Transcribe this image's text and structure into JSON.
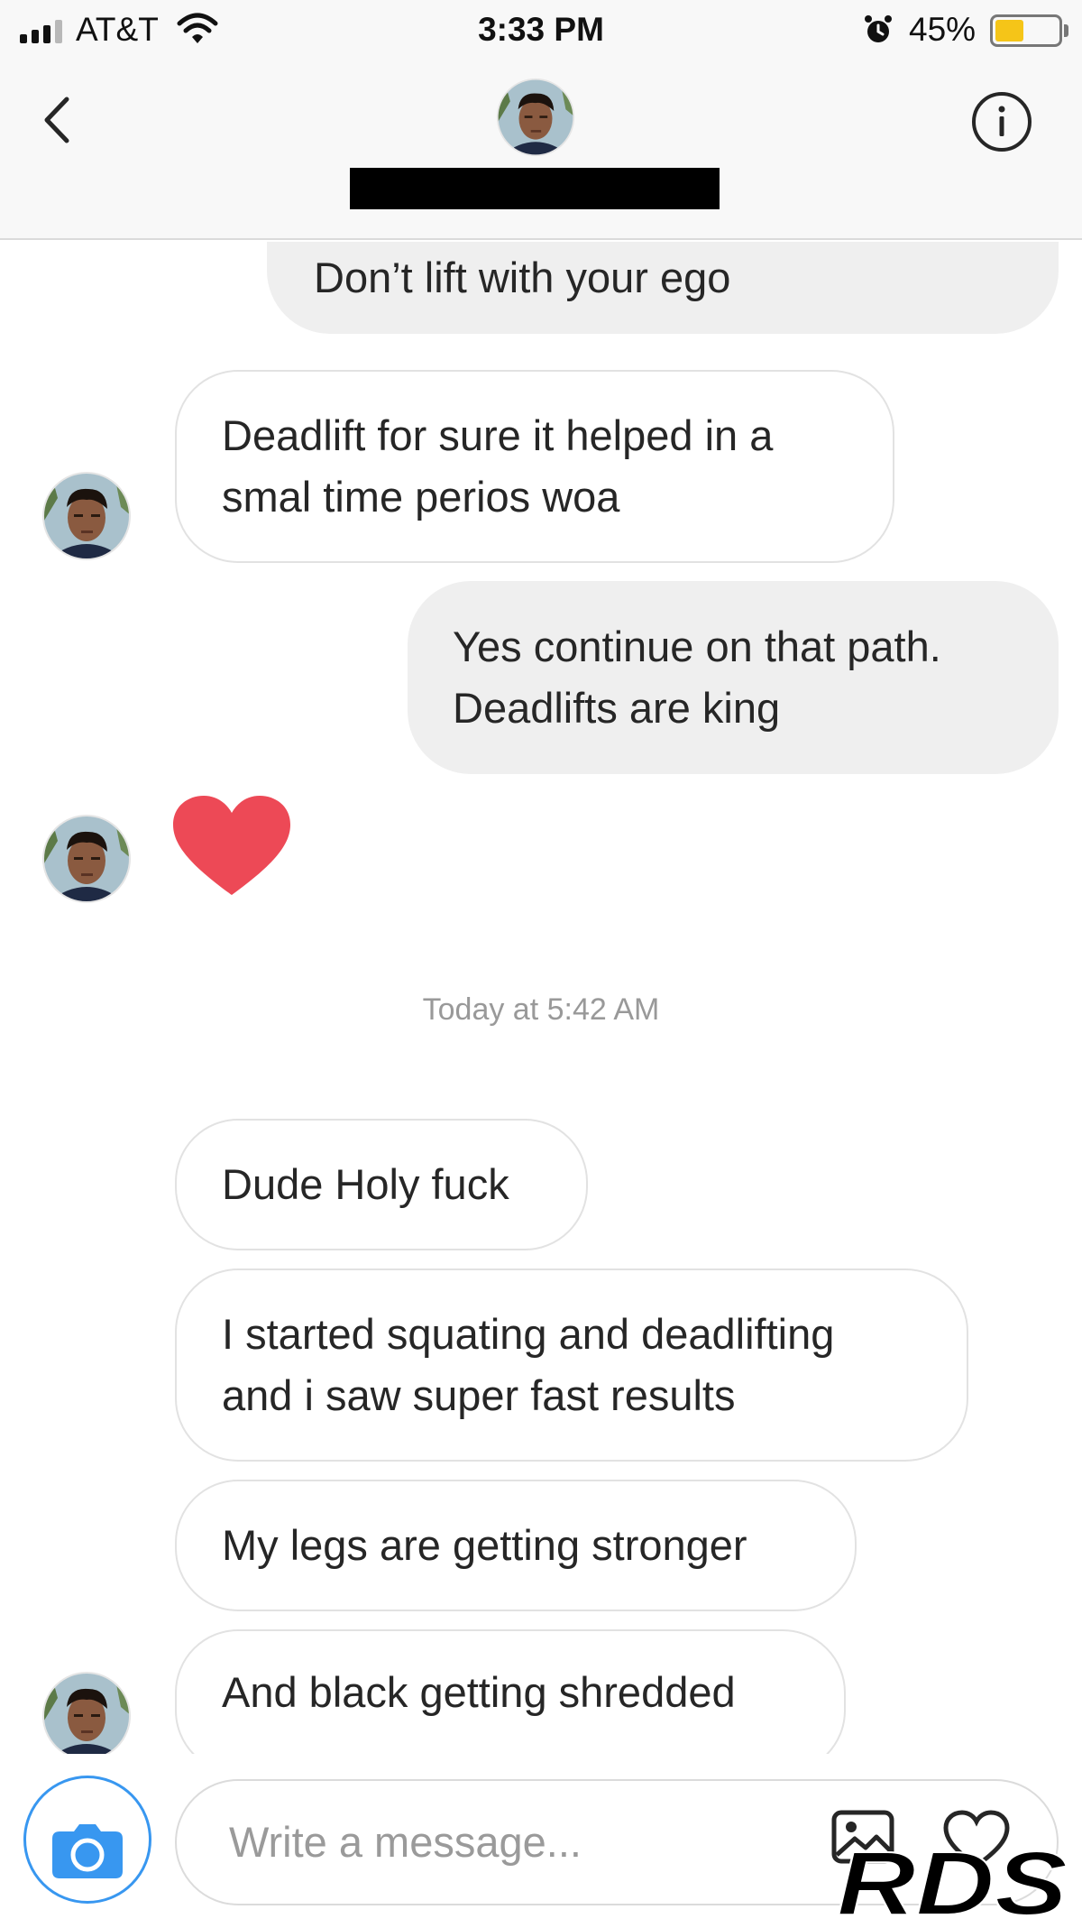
{
  "status_bar": {
    "carrier": "AT&T",
    "time": "3:33 PM",
    "battery_percent": "45%",
    "battery_level": 0.45,
    "battery_color": "#f5c518",
    "signal_bars_on": 3,
    "signal_bars_total": 4
  },
  "header": {
    "back_icon": "chevron-left-icon",
    "info_icon": "info-icon",
    "contact_name_redacted": true
  },
  "messages": [
    {
      "direction": "outgoing",
      "text": "Don’t lift with your ego"
    },
    {
      "direction": "incoming",
      "text": "Deadlift for sure it helped in a\nsmal time perios woa"
    },
    {
      "direction": "outgoing",
      "text": "Yes continue on that path.\nDeadlifts are king"
    },
    {
      "direction": "incoming",
      "type": "heart",
      "icon": "heart-icon",
      "color": "#ed4956"
    },
    {
      "direction": "incoming",
      "text": "Dude Holy fuck"
    },
    {
      "direction": "incoming",
      "text": "I started squating and deadlifting\nand i saw super fast results"
    },
    {
      "direction": "incoming",
      "text": "My legs are getting stronger"
    },
    {
      "direction": "incoming",
      "text": "And black getting shredded"
    }
  ],
  "timestamp": "Today at 5:42 AM",
  "composer": {
    "placeholder": "Write a message...",
    "camera_icon": "camera-icon",
    "gallery_icon": "gallery-icon",
    "like_icon": "heart-outline-icon",
    "accent_color": "#3897f0"
  },
  "watermark": {
    "text": "RDS"
  }
}
